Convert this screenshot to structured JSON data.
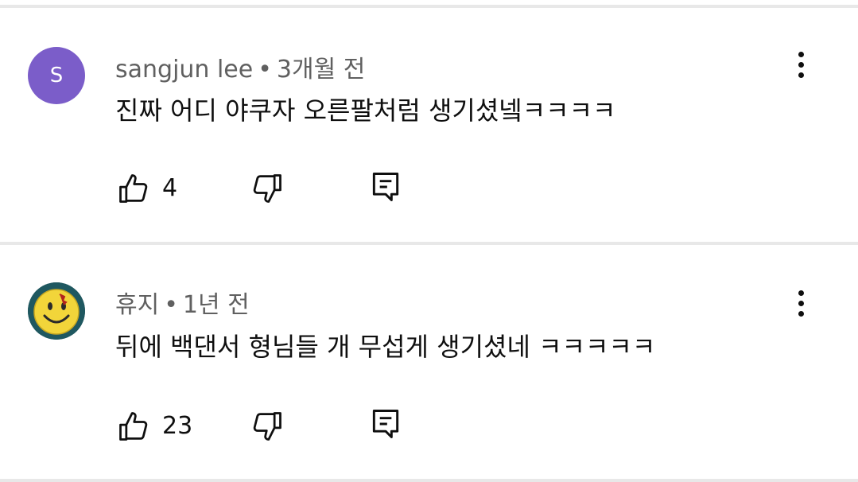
{
  "comments": [
    {
      "avatar_letter": "S",
      "avatar_color": "#7b5dc9",
      "author": "sangjun lee",
      "separator": "•",
      "time": "3개월 전",
      "text": "진짜 어디 야쿠자 오른팔처럼 생기셨넼ㅋㅋㅋㅋ",
      "likes": "4"
    },
    {
      "avatar_icon": "smiley-badge-icon",
      "author": "휴지",
      "separator": "•",
      "time": "1년 전",
      "text": "뒤에 백댄서 형님들 개 무섭게 생기셨네 ㅋㅋㅋㅋㅋ",
      "likes": "23"
    }
  ],
  "icons": {
    "like": "thumbs-up-icon",
    "dislike": "thumbs-down-icon",
    "reply": "reply-icon",
    "more": "more-vert-icon"
  }
}
